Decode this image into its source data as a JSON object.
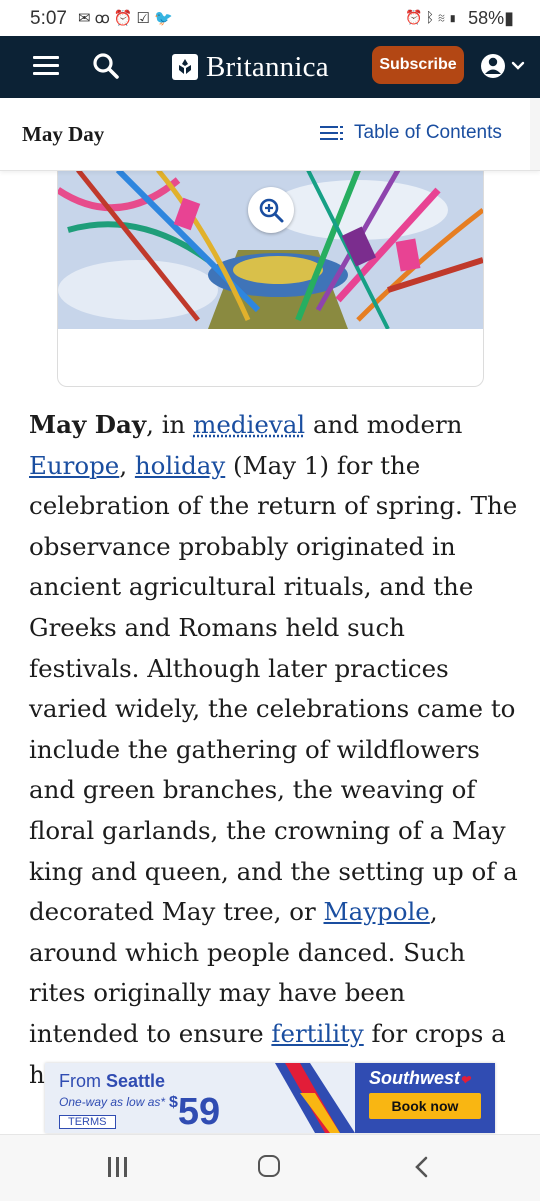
{
  "status_bar": {
    "time": "5:07",
    "left_icons": [
      "mail-icon",
      "voicemail-icon",
      "alarm-icon",
      "check-box-icon",
      "twitter-icon"
    ],
    "right_icons": [
      "alarm-icon",
      "bluetooth-icon",
      "wifi-icon",
      "signal-icon"
    ],
    "battery": "58%"
  },
  "header": {
    "brand": "Britannica",
    "subscribe_label": "Subscribe",
    "bg_color": "#0c2235",
    "accent_color": "#b34714"
  },
  "titlebar": {
    "article_title": "May Day",
    "toc_label": "Table of Contents"
  },
  "article": {
    "lead": "May Day",
    "t1": ", in ",
    "link_medieval": "medieval",
    "t2": " and modern ",
    "link_europe": "Europe",
    "t3": ", ",
    "link_holiday": "holiday",
    "t4": " (May 1) for the celebration of the return of spring. The observance probably originated in ancient agricultural rituals, and the Greeks and Romans held such festivals. Although later practices varied widely, the celebrations came to include the gathering of wildflowers and green branches, the weaving of floral garlands, the crowning of a May king and queen, and the setting up of a decorated May tree, or ",
    "link_maypole": "Maypole",
    "t5": ", around which people danced. Such rites originally may have been intended to ensure ",
    "link_fertility": "fertility",
    "t6": " for crops a",
    "t7": "h"
  },
  "ad": {
    "from_prefix": "From ",
    "from_city": "Seattle",
    "oneway": "One-way as low as*",
    "terms": "TERMS",
    "dollar": "$",
    "price": "59",
    "brand": "Southwest",
    "book_now": "Book now"
  }
}
